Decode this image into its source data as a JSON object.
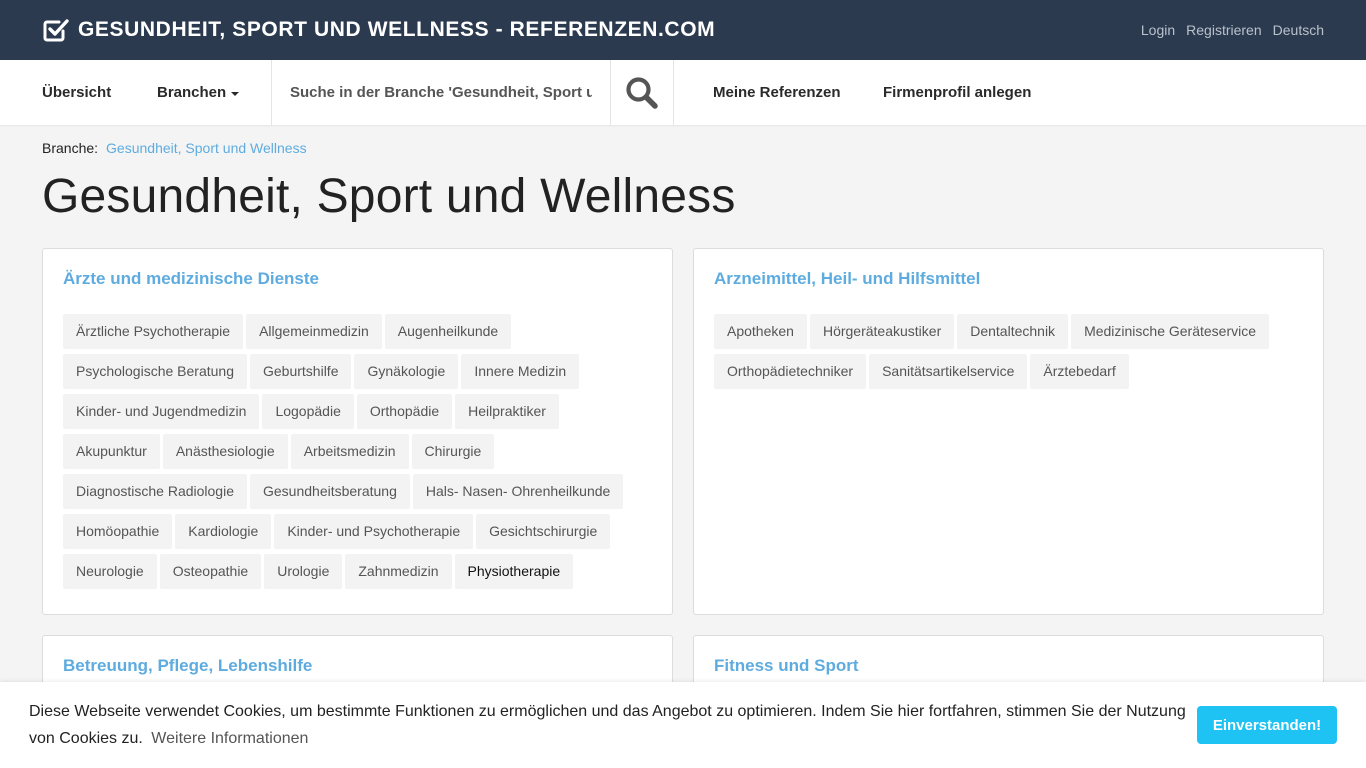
{
  "header": {
    "brand_title": "GESUNDHEIT, SPORT UND WELLNESS - REFERENZEN.COM",
    "links": {
      "login": "Login",
      "register": "Registrieren",
      "language": "Deutsch"
    }
  },
  "nav": {
    "overview": "Übersicht",
    "branches": "Branchen",
    "search_placeholder": "Suche in der Branche 'Gesundheit, Sport und Wellness'",
    "search_value": "Suche in der Branche 'Gesundheit, Sport un…",
    "my_references": "Meine Referenzen",
    "create_profile": "Firmenprofil anlegen"
  },
  "breadcrumb": {
    "label": "Branche:",
    "current": "Gesundheit, Sport und Wellness"
  },
  "page_title": "Gesundheit, Sport und Wellness",
  "categories": [
    {
      "title": "Ärzte und medizinische Dienste",
      "tags": [
        "Ärztliche Psychotherapie",
        "Allgemeinmedizin",
        "Augenheilkunde",
        "Psychologische Beratung",
        "Geburtshilfe",
        "Gynäkologie",
        "Innere Medizin",
        "Kinder- und Jugendmedizin",
        "Logopädie",
        "Orthopädie",
        "Heilpraktiker",
        "Akupunktur",
        "Anästhesiologie",
        "Arbeitsmedizin",
        "Chirurgie",
        "Diagnostische Radiologie",
        "Gesundheitsberatung",
        "Hals- Nasen- Ohrenheilkunde",
        "Homöopathie",
        "Kardiologie",
        "Kinder- und Psychotherapie",
        "Gesichtschirurgie",
        "Neurologie",
        "Osteopathie",
        "Urologie",
        "Zahnmedizin",
        "Physiotherapie"
      ]
    },
    {
      "title": "Arzneimittel, Heil- und Hilfsmittel",
      "tags": [
        "Apotheken",
        "Hörgeräteakustiker",
        "Dentaltechnik",
        "Medizinische Geräteservice",
        "Orthopädietechniker",
        "Sanitätsartikelservice",
        "Ärztebedarf"
      ]
    },
    {
      "title": "Betreuung, Pflege, Lebenshilfe",
      "tags": []
    },
    {
      "title": "Fitness und Sport",
      "tags": []
    }
  ],
  "cookie": {
    "text": "Diese Webseite verwendet Cookies, um bestimmte Funktionen zu ermöglichen und das Angebot zu optimieren. Indem Sie hier fortfahren, stimmen Sie der Nutzung von Cookies zu.",
    "more": "Weitere Informationen",
    "accept": "Einverstanden!"
  },
  "icons": {
    "brand": "checkbox-check-icon",
    "search": "search-icon",
    "caret": "caret-down-icon"
  },
  "colors": {
    "topbar": "#2c3a4f",
    "link": "#5eacdf",
    "accept_button": "#1ec2f3"
  }
}
